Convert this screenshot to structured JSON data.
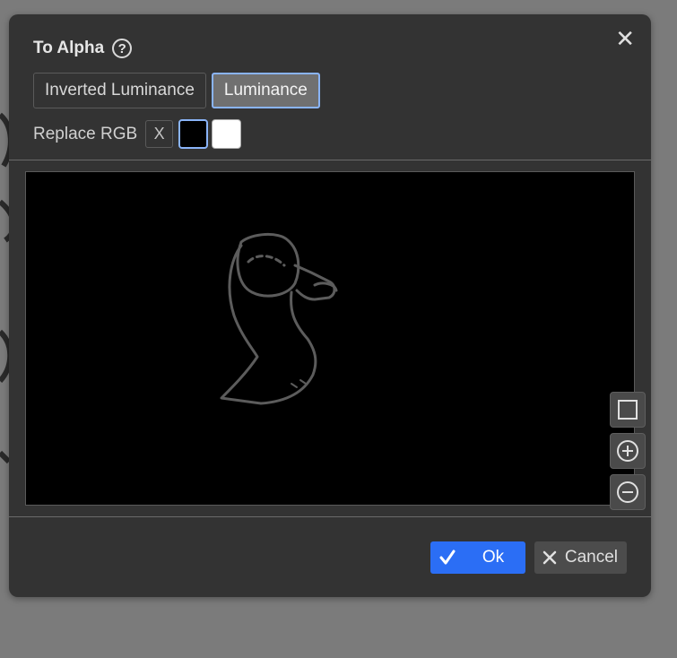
{
  "dialog": {
    "title": "To Alpha",
    "help_icon": "?",
    "close_icon": "✕"
  },
  "modes": [
    {
      "label": "Inverted Luminance",
      "selected": false
    },
    {
      "label": "Luminance",
      "selected": true
    }
  ],
  "replace_rgb": {
    "label": "Replace RGB",
    "clear_label": "X",
    "swatches": [
      "#000000",
      "#ffffff"
    ]
  },
  "preview_tools": [
    "fit-view-icon",
    "zoom-in-icon",
    "zoom-out-icon"
  ],
  "footer": {
    "ok_label": "Ok",
    "cancel_label": "Cancel"
  },
  "colors": {
    "accent": "#2b6ef5",
    "selection_border": "#8ab4f8",
    "dialog_bg": "#333333",
    "backdrop": "#7b7b7b"
  }
}
